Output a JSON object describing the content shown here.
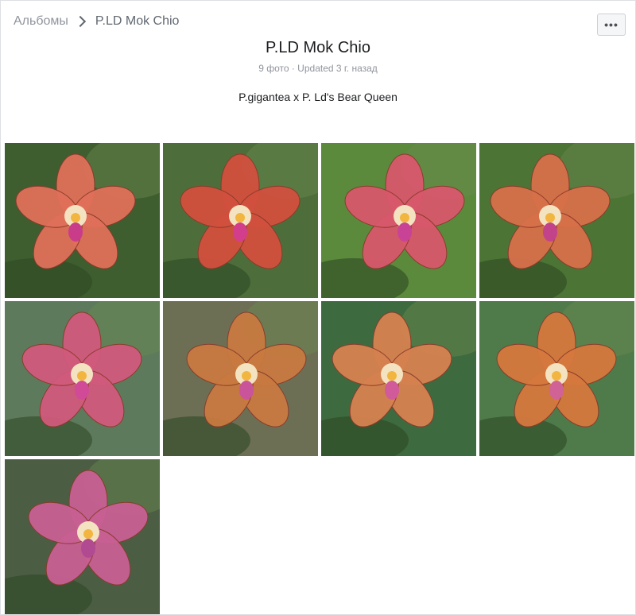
{
  "breadcrumb": {
    "parent": "Альбомы",
    "current": "P.LD Mok Chio"
  },
  "more_button": {
    "label": "•••"
  },
  "album": {
    "title": "P.LD Mok Chio",
    "meta": "9 фото · Updated 3 г. назад",
    "description": "P.gigantea x P. Ld's Bear Queen"
  },
  "photos": [
    {
      "bg": "#3e5e2f",
      "petal": "#e0705a",
      "accent": "#c93c8a"
    },
    {
      "bg": "#4d6e3a",
      "petal": "#d2503e",
      "accent": "#d23e8c"
    },
    {
      "bg": "#5b8a3c",
      "petal": "#d8586c",
      "accent": "#c84396"
    },
    {
      "bg": "#4c7434",
      "petal": "#d7704a",
      "accent": "#c2438a"
    },
    {
      "bg": "#5e7a5c",
      "petal": "#d05a7c",
      "accent": "#d04a98"
    },
    {
      "bg": "#6d6f55",
      "petal": "#c87a40",
      "accent": "#c9549a"
    },
    {
      "bg": "#3e6a3f",
      "petal": "#d68250",
      "accent": "#d05a9a"
    },
    {
      "bg": "#4f7a4a",
      "petal": "#d5783e",
      "accent": "#d06296"
    },
    {
      "bg": "#4b5e44",
      "petal": "#c86094",
      "accent": "#b24a92"
    }
  ],
  "colors": {
    "text": "#1c1e21",
    "muted": "#90949c",
    "border": "#dddfe2"
  }
}
